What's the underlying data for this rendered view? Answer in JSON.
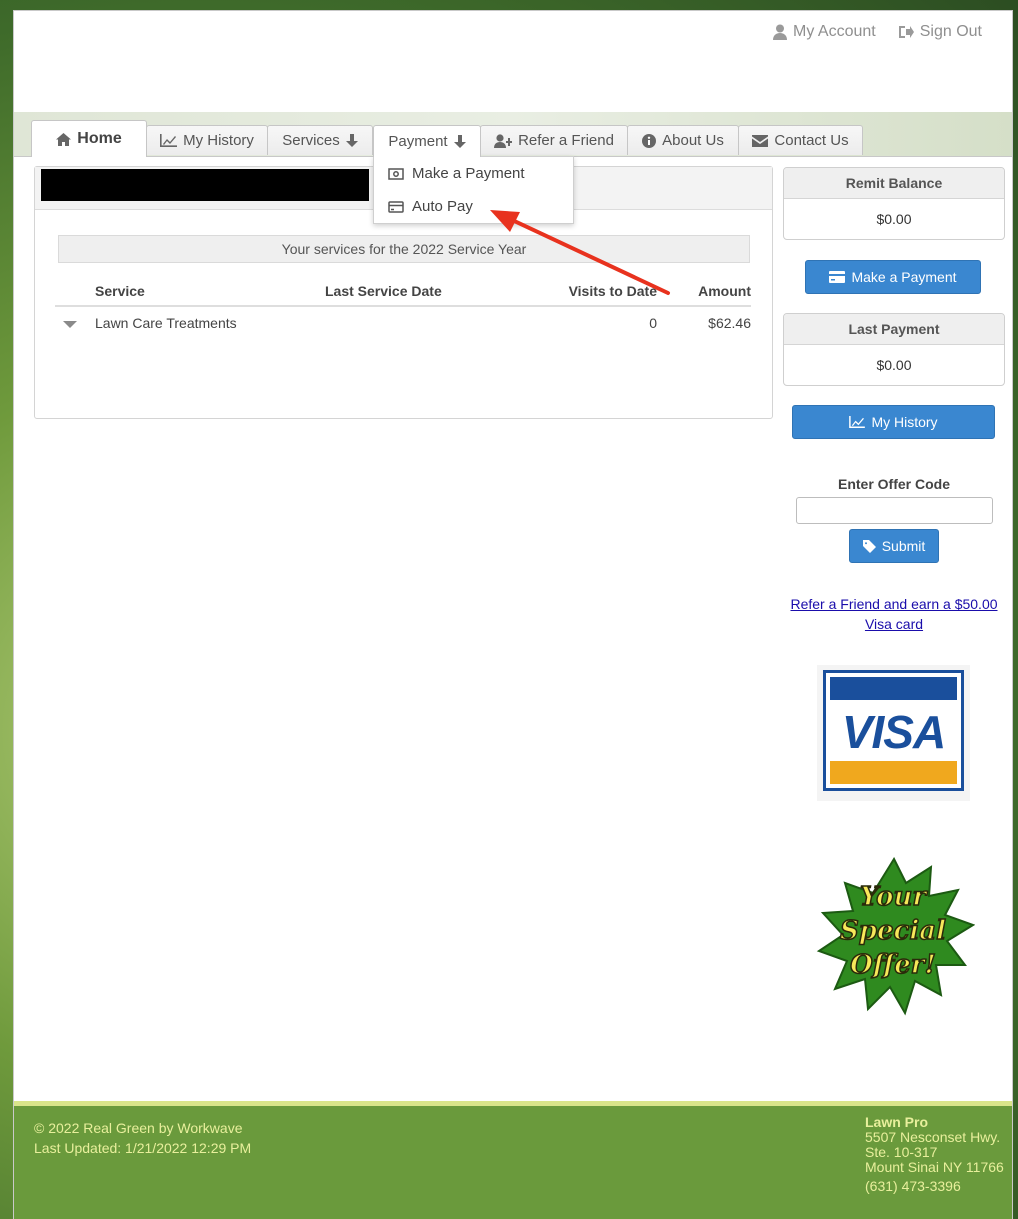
{
  "header": {
    "my_account": "My Account",
    "sign_out": "Sign Out"
  },
  "nav": {
    "tabs": [
      {
        "label": "Home",
        "icon": "home-icon"
      },
      {
        "label": "My History",
        "icon": "chart-icon"
      },
      {
        "label": "Services",
        "icon": "arrow-down-icon"
      },
      {
        "label": "Payment",
        "icon": "arrow-down-icon"
      },
      {
        "label": "Refer a Friend",
        "icon": "user-plus-icon"
      },
      {
        "label": "About Us",
        "icon": "info-icon"
      },
      {
        "label": "Contact Us",
        "icon": "envelope-icon"
      }
    ],
    "payment_menu": [
      {
        "label": "Make a Payment",
        "icon": "money-icon"
      },
      {
        "label": "Auto Pay",
        "icon": "credit-card-icon"
      }
    ]
  },
  "services": {
    "banner": "Your services for the 2022 Service Year",
    "columns": [
      "Service",
      "Last Service Date",
      "Visits to Date",
      "Amount"
    ],
    "rows": [
      {
        "service": "Lawn Care Treatments",
        "last_date": "",
        "visits": "0",
        "amount": "$62.46"
      }
    ]
  },
  "sidebar": {
    "remit_title": "Remit Balance",
    "remit_value": "$0.00",
    "make_payment_btn": "Make a Payment",
    "last_payment_title": "Last Payment",
    "last_payment_value": "$0.00",
    "history_btn": "My History",
    "offer_label": "Enter Offer Code",
    "submit_btn": "Submit",
    "refer_line1": "Refer a Friend and earn a $50.00",
    "refer_line2": "Visa card",
    "visa_text": "VISA",
    "special_text": [
      "Your",
      "Special",
      "Offer!"
    ]
  },
  "footer": {
    "copyright": "© 2022 Real Green by Workwave",
    "updated": "Last Updated: 1/21/2022 12:29 PM",
    "company": "Lawn Pro",
    "addr1": "5507 Nesconset Hwy.",
    "addr2": "Ste. 10-317",
    "addr3": "Mount Sinai NY 11766",
    "phone": "(631) 473-3396"
  },
  "colors": {
    "accent_blue": "#3a87d0",
    "footer_green": "#6a9a3c",
    "footer_text": "#e8ef9c",
    "annotation_red": "#e8321e"
  }
}
